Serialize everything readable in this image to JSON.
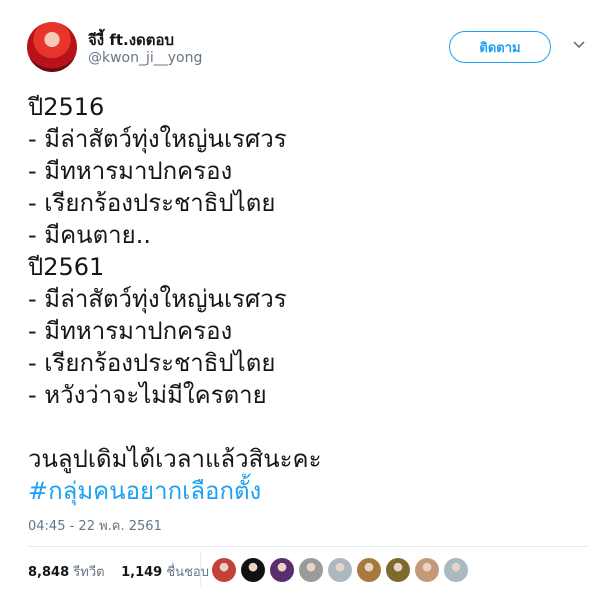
{
  "user": {
    "display_name": "จีงี้ ft.งดตอบ",
    "handle": "@kwon_ji__yong",
    "follow_label": "ติดตาม"
  },
  "tweet": {
    "lines": [
      "ปี2516",
      "- มีล่าสัตว์ทุ่งใหญ่นเรศวร",
      "- มีทหารมาปกครอง",
      "- เรียกร้องประชาธิปไตย",
      "- มีคนตาย..",
      "ปี2561",
      "- มีล่าสัตว์ทุ่งใหญ่นเรศวร",
      "- มีทหารมาปกครอง",
      "- เรียกร้องประชาธิปไตย",
      "- หวังว่าจะไม่มีใครตาย",
      "",
      "วนลูปเดิมได้เวลาแล้วสินะคะ"
    ],
    "hashtag": "#กลุ่มคนอยากเลือกตั้ง",
    "timestamp": "04:45 - 22 พ.ค. 2561"
  },
  "stats": {
    "retweets_count": "8,848",
    "retweets_label": "รีทวีต",
    "likes_count": "1,149",
    "likes_label": "ชื่นชอบ"
  },
  "liker_avatar_colors": [
    "#c2413a",
    "#111111",
    "#5b2d6e",
    "#9a9a9a",
    "#aab8c2",
    "#a57a3c",
    "#7d6a2f",
    "#c29a7a",
    "#aab8c2"
  ],
  "colors": {
    "accent": "#1da1f2",
    "text": "#14171a",
    "muted": "#657786",
    "border": "#e6ecf0"
  }
}
